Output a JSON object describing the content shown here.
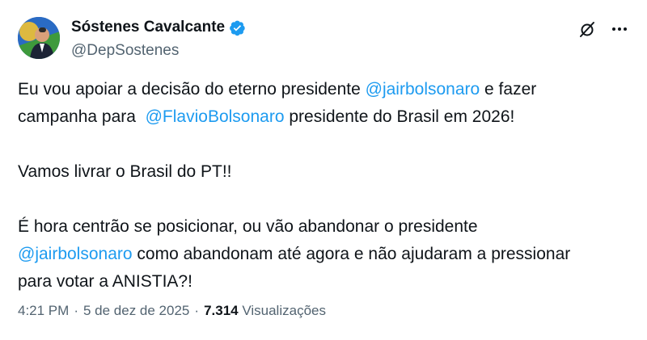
{
  "author": {
    "display_name": "Sóstenes Cavalcante",
    "handle": "@DepSostenes",
    "verified_color": "#1d9bf0"
  },
  "tweet": {
    "line1_a": "Eu vou apoiar a decisão do eterno presidente ",
    "line1_mention": "@jairbolsonaro",
    "line1_b": " e fazer",
    "line2_a": "campanha para  ",
    "line2_mention": "@FlavioBolsonaro",
    "line2_b": " presidente do Brasil em 2026!",
    "para2": "Vamos livrar o Brasil do PT!!",
    "para3_line1": "É hora centrão se posicionar, ou vão abandonar o presidente",
    "para3_line2_mention": "@jairbolsonaro",
    "para3_line2_b": " como abandonam até agora e não ajudaram a pressionar",
    "para3_line3": "para votar a ANISTIA?!"
  },
  "meta": {
    "time": "4:21 PM",
    "separator": "·",
    "date": "5 de dez de 2025",
    "views_count": "7.314",
    "views_label": "Visualizações"
  },
  "icons": {
    "verified": "verified-badge-icon",
    "grok": "grok-icon",
    "more": "more-options-icon"
  },
  "colors": {
    "mention": "#1d9bf0",
    "secondary_text": "#536471",
    "primary_text": "#0f1419"
  }
}
